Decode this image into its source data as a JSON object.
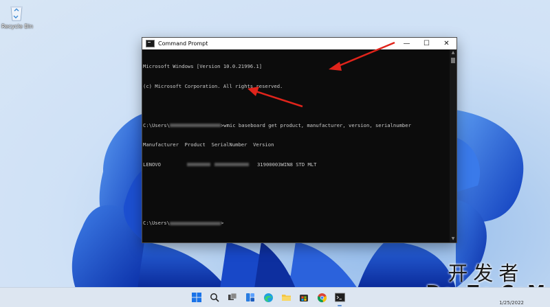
{
  "desktop": {
    "recycle_bin_label": "Recycle Bin"
  },
  "cmd": {
    "title": "Command Prompt",
    "controls": {
      "minimize": "—",
      "maximize": "☐",
      "close": "✕"
    },
    "lines": {
      "l1": "Microsoft Windows [Version 10.0.21996.1]",
      "l2": "(c) Microsoft Corporation. All rights reserved.",
      "prompt_prefix": "C:\\Users\\",
      "command": ">wmic baseboard get product, manufacturer, version, serialnumber",
      "header": "Manufacturer  Product  SerialNumber  Version",
      "row_manufacturer": "LENOVO",
      "row_version": "31900003WIN8 STD MLT",
      "prompt_end": ">"
    }
  },
  "taskbar": {
    "date": "1/25/2022",
    "icons": [
      "windows-start-icon",
      "search-icon",
      "task-view-icon",
      "widgets-icon",
      "edge-icon",
      "file-explorer-icon",
      "store-icon",
      "chrome-icon",
      "terminal-icon"
    ]
  },
  "watermark": {
    "chinese": "开发者",
    "english": "DevZe.CoM"
  },
  "colors": {
    "console_bg": "#0c0c0c",
    "console_text": "#cccccc",
    "arrow": "#e0241b",
    "taskbar": "#dde6f1"
  }
}
